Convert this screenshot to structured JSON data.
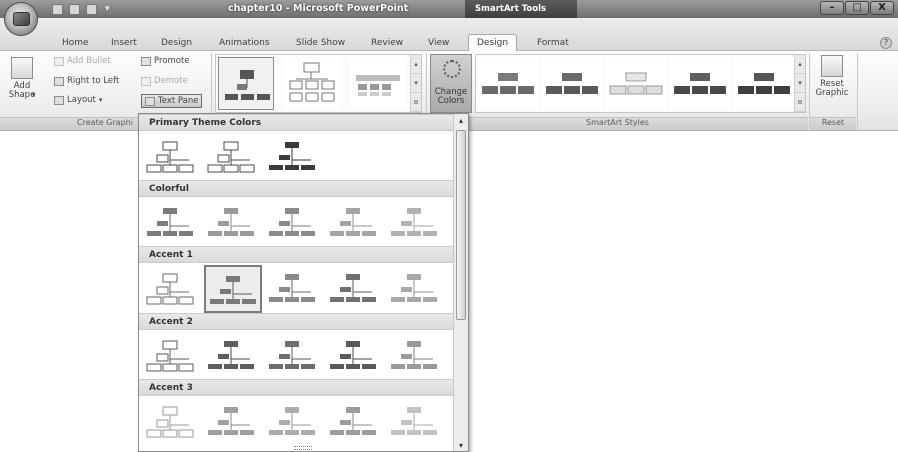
{
  "window": {
    "title": "chapter10 - Microsoft PowerPoint",
    "contextual_tab": "SmartArt Tools",
    "controls": [
      "–",
      "□",
      "X"
    ]
  },
  "tabs": [
    {
      "label": "Home",
      "active": false
    },
    {
      "label": "Insert",
      "active": false
    },
    {
      "label": "Design",
      "active": false
    },
    {
      "label": "Animations",
      "active": false
    },
    {
      "label": "Slide Show",
      "active": false
    },
    {
      "label": "Review",
      "active": false
    },
    {
      "label": "View",
      "active": false
    },
    {
      "label": "Design",
      "active": true
    },
    {
      "label": "Format",
      "active": false
    }
  ],
  "help_glyph": "?",
  "ribbon": {
    "add_shape": "Add\nShape",
    "add_shape_arrow": "▾",
    "add_bullet": "Add Bullet",
    "right_to_left": "Right to Left",
    "layout": "Layout",
    "dropdown_arrow": "▾",
    "promote": "Promote",
    "demote": "Demote",
    "text_pane": "Text Pane",
    "group_create_graphic": "Create Graphi",
    "change_colors": "Change\nColors",
    "group_smartart_styles": "SmartArt Styles",
    "reset_graphic": "Reset\nGraphic",
    "group_reset": "Reset",
    "scroll_up": "▴",
    "scroll_down": "▾",
    "scroll_more": "≡"
  },
  "gallery": {
    "sections": [
      {
        "title": "Primary Theme Colors",
        "tiles": [
          {
            "style": "outline",
            "box": "#ffffff",
            "stroke": "#4a4a4a",
            "line": "#4a4a4a"
          },
          {
            "style": "outline",
            "box": "#ffffff",
            "stroke": "#4a4a4a",
            "line": "#4a4a4a"
          },
          {
            "style": "filled",
            "box": "#3a3a3a",
            "stroke": "#3a3a3a",
            "line": "#3a3a3a"
          }
        ]
      },
      {
        "title": "Colorful",
        "tiles": [
          {
            "style": "filled",
            "box": "#7c7c7c",
            "stroke": "#7c7c7c",
            "line": "#6a6a6a"
          },
          {
            "style": "filled",
            "box": "#9a9a9a",
            "stroke": "#9a9a9a",
            "line": "#8a8a8a"
          },
          {
            "style": "filled",
            "box": "#8a8a8a",
            "stroke": "#8a8a8a",
            "line": "#7a7a7a"
          },
          {
            "style": "filled",
            "box": "#a4a4a4",
            "stroke": "#a4a4a4",
            "line": "#909090"
          },
          {
            "style": "filled",
            "box": "#b2b2b2",
            "stroke": "#b2b2b2",
            "line": "#a0a0a0"
          }
        ]
      },
      {
        "title": "Accent 1",
        "tiles": [
          {
            "style": "outline",
            "box": "#ffffff",
            "stroke": "#6a6a6a",
            "line": "#6a6a6a"
          },
          {
            "style": "filled",
            "box": "#7a7a7a",
            "stroke": "#7a7a7a",
            "line": "#5a5a5a",
            "selected": true
          },
          {
            "style": "filled",
            "box": "#8a8a8a",
            "stroke": "#8a8a8a",
            "line": "#6a6a6a"
          },
          {
            "style": "filled",
            "box": "#707070",
            "stroke": "#707070",
            "line": "#5a5a5a"
          },
          {
            "style": "filled",
            "box": "#a8a8a8",
            "stroke": "#a8a8a8",
            "line": "#909090"
          }
        ]
      },
      {
        "title": "Accent 2",
        "tiles": [
          {
            "style": "outline",
            "box": "#ffffff",
            "stroke": "#5a5a5a",
            "line": "#5a5a5a"
          },
          {
            "style": "filled",
            "box": "#5e5e5e",
            "stroke": "#5e5e5e",
            "line": "#4a4a4a"
          },
          {
            "style": "filled",
            "box": "#6e6e6e",
            "stroke": "#6e6e6e",
            "line": "#5a5a5a"
          },
          {
            "style": "filled",
            "box": "#5a5a5a",
            "stroke": "#5a5a5a",
            "line": "#4a4a4a"
          },
          {
            "style": "filled",
            "box": "#9a9a9a",
            "stroke": "#9a9a9a",
            "line": "#808080"
          }
        ]
      },
      {
        "title": "Accent 3",
        "tiles": [
          {
            "style": "outline",
            "box": "#ffffff",
            "stroke": "#9a9a9a",
            "line": "#9a9a9a"
          },
          {
            "style": "filled",
            "box": "#a0a0a0",
            "stroke": "#a0a0a0",
            "line": "#8a8a8a"
          },
          {
            "style": "filled",
            "box": "#acacac",
            "stroke": "#acacac",
            "line": "#969696"
          },
          {
            "style": "filled",
            "box": "#9c9c9c",
            "stroke": "#9c9c9c",
            "line": "#888888"
          },
          {
            "style": "filled",
            "box": "#c2c2c2",
            "stroke": "#c2c2c2",
            "line": "#aaaaaa"
          }
        ]
      }
    ]
  },
  "colors": {
    "titlebar": "#7d7d7d",
    "ribbon": "#eeeeee",
    "section_header": "#dedede"
  }
}
